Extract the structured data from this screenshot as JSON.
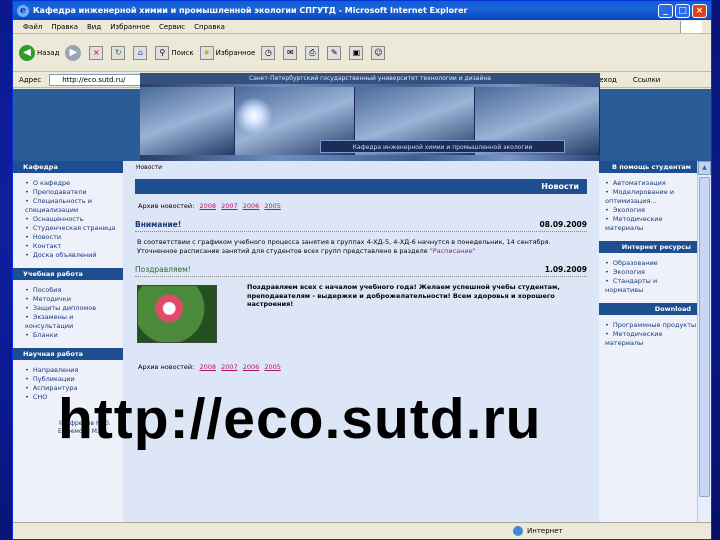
{
  "window": {
    "title": "Кафедра инженерной химии и промышленной экологии СПГУТД - Microsoft Internet Explorer",
    "minimize": "_",
    "maximize": "□",
    "close": "×"
  },
  "menubar": {
    "items": [
      "Файл",
      "Правка",
      "Вид",
      "Избранное",
      "Сервис",
      "Справка"
    ]
  },
  "toolbar": {
    "back": "Назад",
    "search": "Поиск",
    "favorites": "Избранное"
  },
  "addressbar": {
    "label": "Адрес",
    "url": "http://eco.sutd.ru/",
    "go": "Переход",
    "links": "Ссылки"
  },
  "banner": {
    "university": "Санкт-Петербургский государственный университет технологии и дизайна",
    "department": "Кафедра инженерной химии и промышленной экологии"
  },
  "left": {
    "sections": [
      {
        "title": "Кафедра",
        "items": [
          "О кафедре",
          "Преподаватели",
          "Специальность и специализации",
          "Оснащенность",
          "Студенческая страница",
          "Новости",
          "Контакт",
          "Доска объявлений"
        ]
      },
      {
        "title": "Учебная работа",
        "items": [
          "Пособия",
          "Методички",
          "Защиты дипломов",
          "Экзамены и консультации",
          "Бланки"
        ]
      },
      {
        "title": "Научная работа",
        "items": [
          "Направления",
          "Публикации",
          "Аспирантура",
          "СНО"
        ]
      }
    ],
    "footer": [
      "© Ефремов Н.Ю.",
      "Ефремова М.Ю."
    ]
  },
  "center": {
    "breadcrumb": "Новости",
    "header": "Новости",
    "archive_label": "Архив новостей:",
    "archive_years": [
      "2008",
      "2007",
      "2006",
      "2005"
    ],
    "news": [
      {
        "title": "Внимание!",
        "date": "08.09.2009",
        "body": "В соответствии с графиком учебного процесса занятия в группах 4-ХД-5, 4-ХД-6 начнутся в понедельник, 14 сентября. Уточненное расписание занятий для студентов всех групп представлено в разделе",
        "link": "\"Расписание\""
      },
      {
        "title": "Поздравляем!",
        "date": "1.09.2009",
        "body": "Поздравляем всех с началом учебного года! Желаем успешной учебы студентам, преподавателям - выдержки и доброжелательности! Всем здоровья и хорошего настроения!"
      }
    ]
  },
  "right": {
    "sections": [
      {
        "title": "В помощь студентам",
        "items": [
          "Автоматизация",
          "Моделирование и оптимизация...",
          "Экология",
          "Методические материалы"
        ]
      },
      {
        "title": "Интернет ресурсы",
        "items": [
          "Образование",
          "Экология",
          "Стандарты и нормативы"
        ]
      },
      {
        "title": "Download",
        "items": [
          "Программные продукты",
          "Методические материалы"
        ]
      }
    ]
  },
  "statusbar": {
    "zone": "Интернет"
  },
  "overlay": {
    "url": "http://eco.sutd.ru"
  },
  "colors": {
    "titlebar": "#0a5fd8",
    "section": "#1d4e8f",
    "link": "#b0156e",
    "slide_bg": "#0b1b95"
  }
}
